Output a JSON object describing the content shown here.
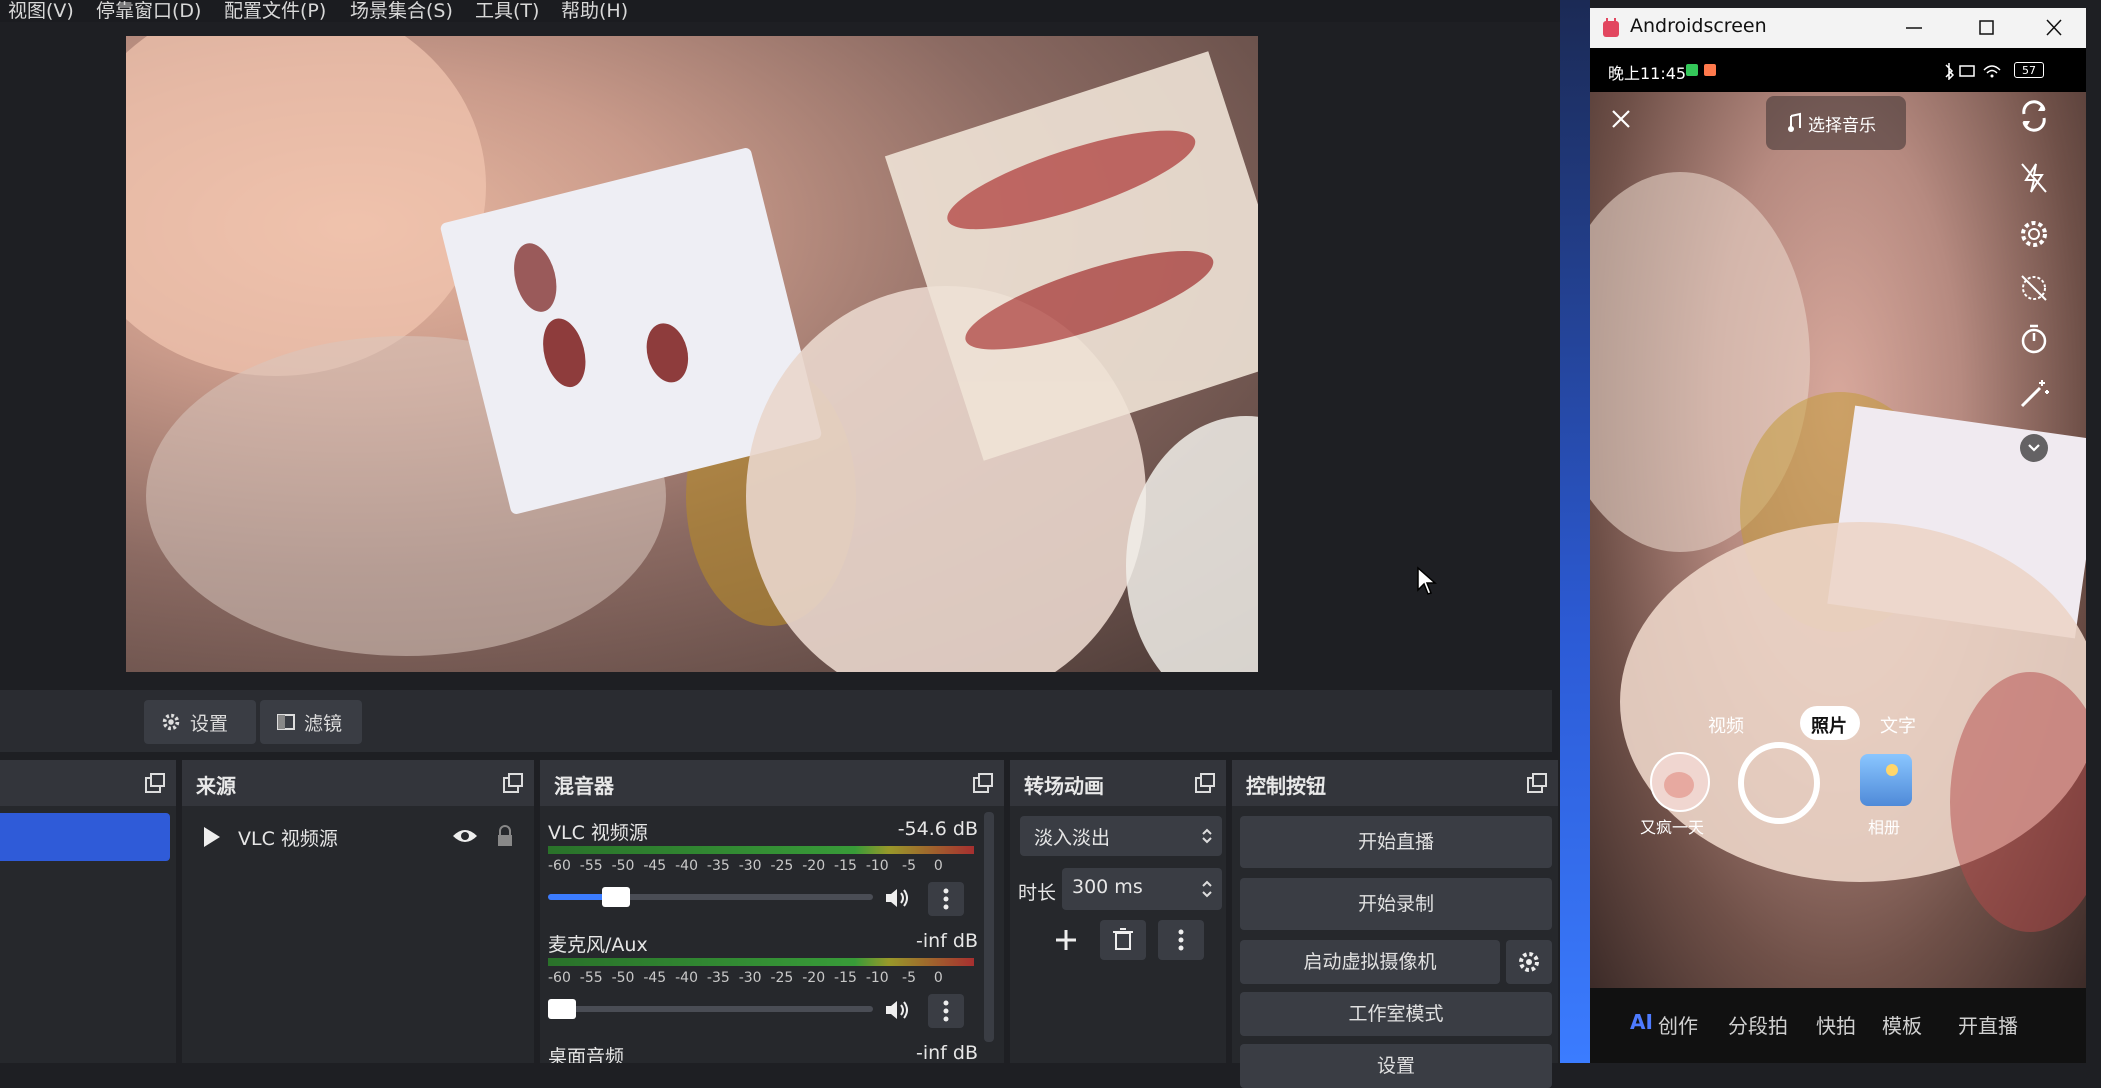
{
  "menubar": {
    "items": [
      "视图(V)",
      "停靠窗口(D)",
      "配置文件(P)",
      "场景集合(S)",
      "工具(T)",
      "帮助(H)"
    ]
  },
  "toolbar": {
    "settings_label": "设置",
    "filters_label": "滤镜"
  },
  "panels": {
    "sources_title": "来源",
    "mixer_title": "混音器",
    "transitions_title": "转场动画",
    "controls_title": "控制按钮"
  },
  "sources": {
    "items": [
      {
        "label": "VLC 视频源"
      }
    ]
  },
  "mixer": {
    "channels": [
      {
        "name": "VLC 视频源",
        "level": "-54.6 dB",
        "volume": 0.2
      },
      {
        "name": "麦克风/Aux",
        "level": "-inf dB",
        "volume": 0.0
      },
      {
        "name": "桌面音频",
        "level": "-inf dB"
      }
    ],
    "scale_ticks": [
      "-60",
      "-55",
      "-50",
      "-45",
      "-40",
      "-35",
      "-30",
      "-25",
      "-20",
      "-15",
      "-10",
      "-5",
      "0"
    ]
  },
  "transitions": {
    "selected": "淡入淡出",
    "duration_label": "时长",
    "duration_value": "300 ms"
  },
  "controls": {
    "start_stream": "开始直播",
    "start_record": "开始录制",
    "virtual_camera": "启动虚拟摄像机",
    "studio_mode": "工作室模式",
    "settings": "设置"
  },
  "android": {
    "window_title": "Androidscreen",
    "status_time": "晚上11:45",
    "battery": "57",
    "music_button": "选择音乐",
    "modes": [
      "视频",
      "照片",
      "文字"
    ],
    "selected_mode": "照片",
    "effect_label": "又疯一天",
    "album_label": "相册",
    "nav": [
      "AI",
      "创作",
      "分段拍",
      "快拍",
      "模板",
      "开直播"
    ]
  },
  "colors": {
    "accent_blue": "#2f5bd8",
    "panel_bg": "#26282c",
    "panel_header": "#33353b"
  }
}
